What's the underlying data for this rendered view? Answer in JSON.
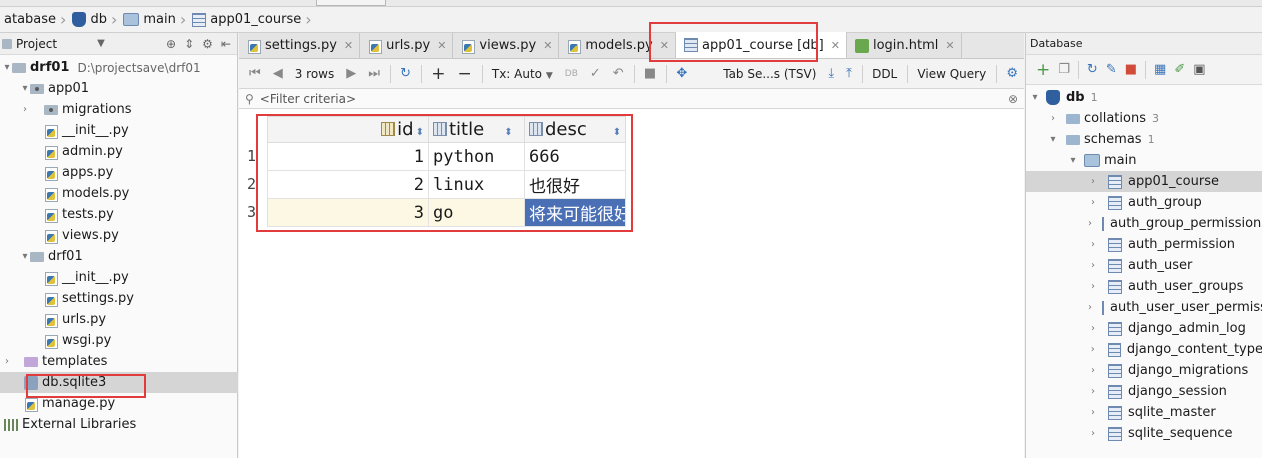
{
  "breadcrumb": {
    "items": [
      {
        "label": "atabase",
        "icon": "database-icon"
      },
      {
        "label": "db",
        "icon": "db-icon"
      },
      {
        "label": "main",
        "icon": "schema-icon"
      },
      {
        "label": "app01_course",
        "icon": "table-icon"
      }
    ]
  },
  "project": {
    "title": "Project",
    "root_label": "drf01",
    "root_path": "D:\\projectsave\\drf01",
    "items": [
      {
        "label": "app01"
      },
      {
        "label": "migrations"
      },
      {
        "label": "__init__.py"
      },
      {
        "label": "admin.py"
      },
      {
        "label": "apps.py"
      },
      {
        "label": "models.py"
      },
      {
        "label": "tests.py"
      },
      {
        "label": "views.py"
      },
      {
        "label": "drf01"
      },
      {
        "label": "__init__.py"
      },
      {
        "label": "settings.py"
      },
      {
        "label": "urls.py"
      },
      {
        "label": "wsgi.py"
      },
      {
        "label": "templates"
      },
      {
        "label": "db.sqlite3"
      },
      {
        "label": "manage.py"
      },
      {
        "label": "External Libraries"
      }
    ]
  },
  "tabs": [
    {
      "label": "settings.py",
      "active": false
    },
    {
      "label": "urls.py",
      "active": false
    },
    {
      "label": "views.py",
      "active": false
    },
    {
      "label": "models.py",
      "active": false
    },
    {
      "label": "app01_course [db]",
      "active": true
    },
    {
      "label": "login.html",
      "active": false
    }
  ],
  "grid_toolbar": {
    "rows_label": "3 rows",
    "tx_label": "Tx: Auto",
    "db_label": "DB",
    "tab_sep_label": "Tab Se...s (TSV)",
    "ddl_label": "DDL",
    "view_query_label": "View Query"
  },
  "filter": {
    "placeholder": "<Filter criteria>"
  },
  "grid": {
    "columns": [
      "id",
      "title",
      "desc"
    ],
    "rows": [
      {
        "num": "1",
        "id": "1",
        "title": "python",
        "desc": "666"
      },
      {
        "num": "2",
        "id": "2",
        "title": "linux",
        "desc": "也很好"
      },
      {
        "num": "3",
        "id": "3",
        "title": "go",
        "desc": "将来可能很好"
      }
    ]
  },
  "db_panel": {
    "title": "Database",
    "db_label": "db",
    "db_count": "1",
    "collations_label": "collations",
    "collations_count": "3",
    "schemas_label": "schemas",
    "schemas_count": "1",
    "main_label": "main",
    "tables": [
      "app01_course",
      "auth_group",
      "auth_group_permissions",
      "auth_permission",
      "auth_user",
      "auth_user_groups",
      "auth_user_user_permissions",
      "django_admin_log",
      "django_content_type",
      "django_migrations",
      "django_session",
      "sqlite_master",
      "sqlite_sequence"
    ]
  },
  "colors": {
    "highlight": "#e23b3b",
    "selection": "#4a6fb5",
    "current_row": "#fdf8e4"
  }
}
